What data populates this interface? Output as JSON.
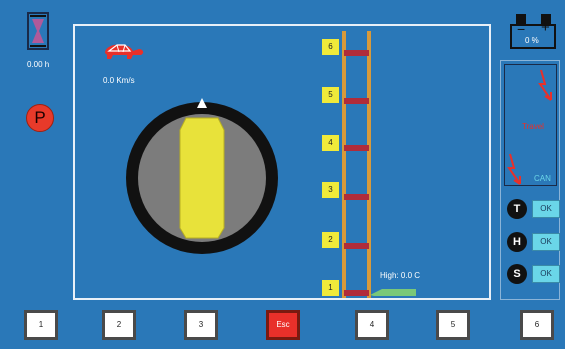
{
  "hours": {
    "value": "0.00 h"
  },
  "speed": {
    "value": "0.0 Km/s"
  },
  "park": {
    "label": "P"
  },
  "battery": {
    "minus": "−",
    "plus": "+",
    "percent": "0 %"
  },
  "status": {
    "travel": "Travel",
    "can": "CAN"
  },
  "indicators": [
    {
      "letter": "T",
      "ok": "OK"
    },
    {
      "letter": "H",
      "ok": "OK"
    },
    {
      "letter": "S",
      "ok": "OK"
    }
  ],
  "levels": [
    "6",
    "5",
    "4",
    "3",
    "2",
    "1"
  ],
  "temperature": {
    "label": "High: 0.0  C"
  },
  "softkeys": [
    "1",
    "2",
    "3",
    "Esc",
    "4",
    "5",
    "6"
  ],
  "colors": {
    "background": "#2a78b8",
    "accent_red": "#e83a2a",
    "level_yellow": "#f0ea3a",
    "ok_cyan": "#6ad6e8"
  }
}
